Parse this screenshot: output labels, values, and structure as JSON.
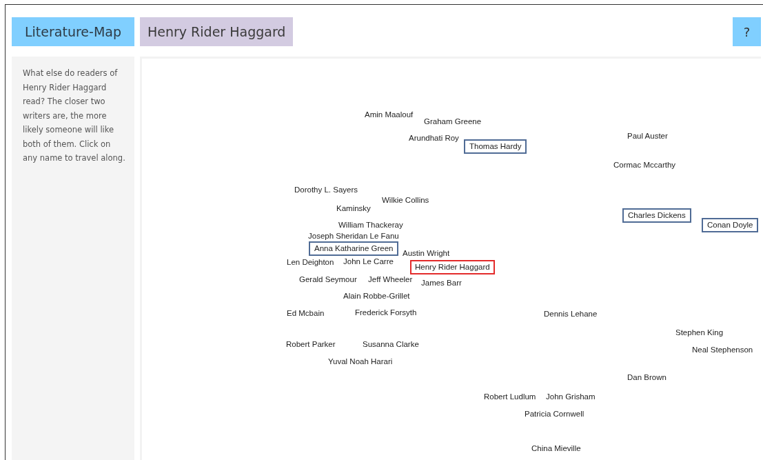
{
  "header": {
    "logo": "Literature-Map",
    "title": "Henry Rider Haggard",
    "help_button": "?"
  },
  "sidebar": {
    "text": "What else do readers of Henry Rider Haggard read? The closer two writers are, the more likely someone will like both of them. Click on any name to travel along."
  },
  "map": {
    "names": [
      {
        "name": "Amin Maalouf",
        "kind": "plain"
      },
      {
        "name": "Graham Greene",
        "kind": "plain"
      },
      {
        "name": "Arundhati Roy",
        "kind": "plain"
      },
      {
        "name": "Thomas Hardy",
        "kind": "boxed"
      },
      {
        "name": "Paul Auster",
        "kind": "plain"
      },
      {
        "name": "Cormac Mccarthy",
        "kind": "plain"
      },
      {
        "name": "Dorothy L. Sayers",
        "kind": "plain"
      },
      {
        "name": "Wilkie Collins",
        "kind": "plain"
      },
      {
        "name": "Kaminsky",
        "kind": "plain"
      },
      {
        "name": "Charles Dickens",
        "kind": "boxed"
      },
      {
        "name": "Conan Doyle",
        "kind": "boxed"
      },
      {
        "name": "William Thackeray",
        "kind": "plain"
      },
      {
        "name": "Joseph Sheridan Le Fanu",
        "kind": "plain"
      },
      {
        "name": "Anna Katharine Green",
        "kind": "boxed"
      },
      {
        "name": "Austin Wright",
        "kind": "plain"
      },
      {
        "name": "Len Deighton",
        "kind": "plain"
      },
      {
        "name": "John Le Carre",
        "kind": "plain"
      },
      {
        "name": "Henry Rider Haggard",
        "kind": "current"
      },
      {
        "name": "Gerald Seymour",
        "kind": "plain"
      },
      {
        "name": "Jeff Wheeler",
        "kind": "plain"
      },
      {
        "name": "James Barr",
        "kind": "plain"
      },
      {
        "name": "Alain Robbe-Grillet",
        "kind": "plain"
      },
      {
        "name": "Ed Mcbain",
        "kind": "plain"
      },
      {
        "name": "Frederick Forsyth",
        "kind": "plain"
      },
      {
        "name": "Dennis Lehane",
        "kind": "plain"
      },
      {
        "name": "Stephen King",
        "kind": "plain"
      },
      {
        "name": "Robert Parker",
        "kind": "plain"
      },
      {
        "name": "Susanna Clarke",
        "kind": "plain"
      },
      {
        "name": "Neal Stephenson",
        "kind": "plain"
      },
      {
        "name": "Yuval Noah Harari",
        "kind": "plain"
      },
      {
        "name": "Dan Brown",
        "kind": "plain"
      },
      {
        "name": "Robert Ludlum",
        "kind": "plain"
      },
      {
        "name": "John Grisham",
        "kind": "plain"
      },
      {
        "name": "Patricia Cornwell",
        "kind": "plain"
      },
      {
        "name": "China Mieville",
        "kind": "plain"
      }
    ]
  }
}
